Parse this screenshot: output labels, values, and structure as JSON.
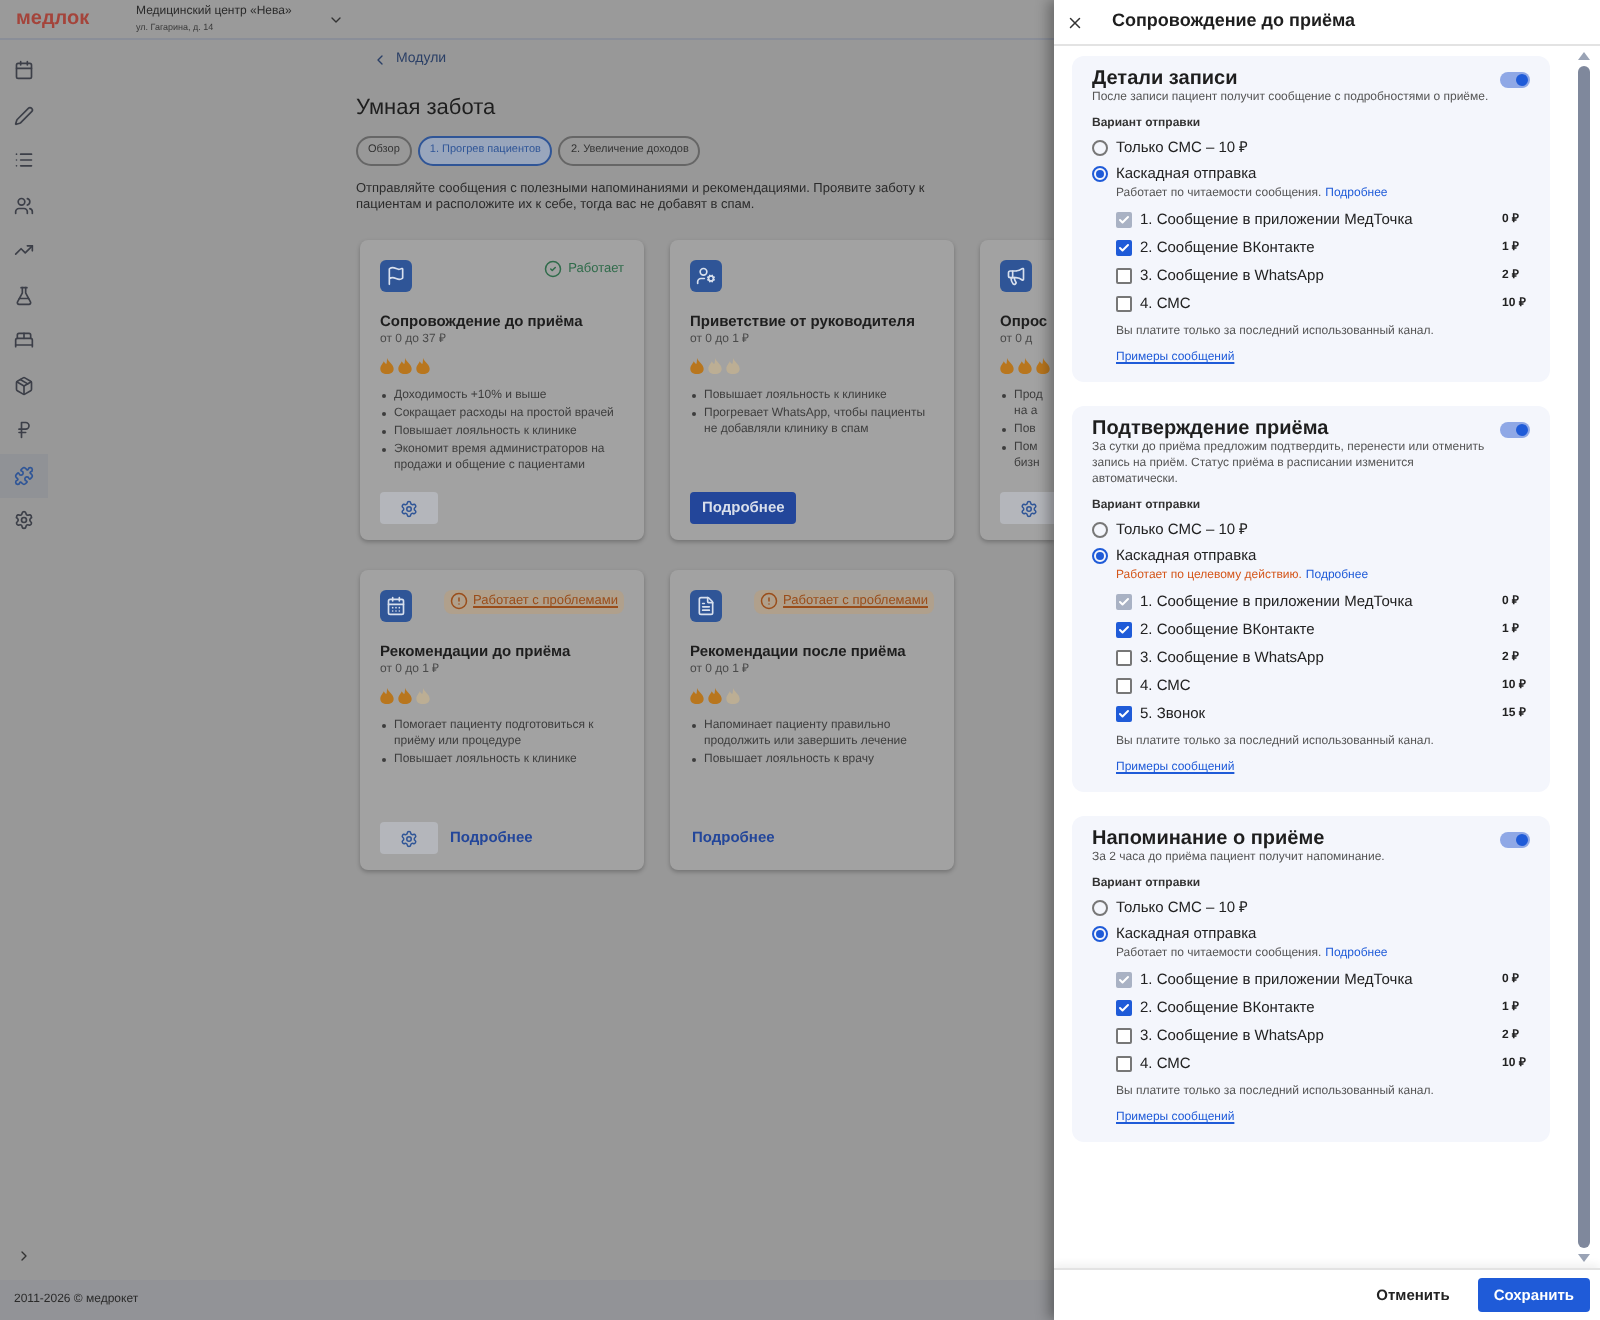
{
  "header": {
    "logo": "медлок",
    "clinic_name": "Медицинский центр «Нева»",
    "clinic_address": "ул. Гагарина, д. 14"
  },
  "sidebar": {
    "items": [
      {
        "selected": false
      },
      {
        "selected": false
      },
      {
        "selected": false
      },
      {
        "selected": false
      },
      {
        "selected": false
      },
      {
        "selected": false
      },
      {
        "selected": false
      },
      {
        "selected": false
      },
      {
        "selected": false
      },
      {
        "selected": true
      },
      {
        "selected": false
      }
    ]
  },
  "breadcrumb": "Модули",
  "page_title": "Умная забота",
  "tabs": [
    {
      "label": "Обзор",
      "selected": false
    },
    {
      "label": "1. Прогрев пациентов",
      "selected": true
    },
    {
      "label": "2. Увеличение доходов",
      "selected": false
    }
  ],
  "intro": "Отправляйте сообщения с полезными напоминаниями и рекомендациями. Проявите заботу к пациентам и расположите их к себе, тогда вас не добавят в спам.",
  "cards": [
    {
      "kind": "flag",
      "status": {
        "kind": "ok",
        "label": "Работает"
      },
      "title": "Сопровождение до приёма",
      "price": "от 0 до 37 ₽",
      "stars": 3,
      "bullets": [
        "Доходимость +10% и выше",
        "Сокращает расходы на простой врачей",
        "Повышает лояльность к клинике",
        "Экономит время администраторов на продажи и общение с пациентами"
      ],
      "settings_button": true
    },
    {
      "kind": "person",
      "title": "Приветствие от руководителя",
      "price": "от 0 до 1 ₽",
      "stars": 1,
      "bullets": [
        "Повышает лояльность к клинике",
        "Прогревает WhatsApp, чтобы пациенты не добавляли клинику в спам"
      ],
      "settings_button": false,
      "details": {
        "kind": "primary",
        "label": "Подробнее"
      }
    },
    {
      "kind": "megaphone",
      "title": "Опрос",
      "price": "от 0 д",
      "stars": 3,
      "bullets": [
        "Прод на а",
        "Пов",
        "Пом бизн"
      ],
      "settings_button": true
    },
    {
      "kind": "calendar",
      "status": {
        "kind": "problem",
        "label": "Работает с проблемами"
      },
      "title": "Рекомендации до приёма",
      "price": "от 0 до 1 ₽",
      "stars": 2,
      "bullets": [
        "Помогает пациенту подготовиться к приёму или процедуре",
        "Повышает лояльность к клинике"
      ],
      "settings_button": true,
      "details": {
        "kind": "link",
        "label": "Подробнее"
      }
    },
    {
      "kind": "document",
      "status": {
        "kind": "problem",
        "label": "Работает с проблемами"
      },
      "title": "Рекомендации после приёма",
      "price": "от 0 до 1 ₽",
      "stars": 2,
      "bullets": [
        "Напоминает пациенту правильно продолжить или завершить лечение",
        "Повышает лояльность к врачу"
      ],
      "settings_button": false,
      "details": {
        "kind": "link",
        "label": "Подробнее"
      }
    }
  ],
  "footer": "2011-2026 © медрокет",
  "panel": {
    "title": "Сопровождение до приёма",
    "sections": [
      {
        "title": "Детали записи",
        "enabled": true,
        "description": "После записи пациент получит сообщение с подробностями о приёме.",
        "variant_label": "Вариант отправки",
        "options": [
          {
            "label": "Только СМС – 10 ₽",
            "selected": false
          },
          {
            "label": "Каскадная отправка",
            "selected": true
          }
        ],
        "note": {
          "kind": "normal",
          "text": "Работает по читаемости сообщения.",
          "link": "Подробнее"
        },
        "channels": [
          {
            "label": "1. Сообщение в приложении МедТочка",
            "price": "0 ₽",
            "checked": true,
            "disabled": true
          },
          {
            "label": "2. Сообщение ВКонтакте",
            "price": "1 ₽",
            "checked": true,
            "disabled": false
          },
          {
            "label": "3. Сообщение в WhatsApp",
            "price": "2 ₽",
            "checked": false,
            "disabled": false
          },
          {
            "label": "4. СМС",
            "price": "10 ₽",
            "checked": false,
            "disabled": false
          }
        ],
        "payment_note": "Вы платите только за последний использованный канал.",
        "examples_link": "Примеры сообщений"
      },
      {
        "title": "Подтверждение приёма",
        "enabled": true,
        "description": "За сутки до приёма предложим подтвердить, перенести или отменить запись на приём. Статус приёма в расписании изменится автоматически.",
        "variant_label": "Вариант отправки",
        "options": [
          {
            "label": "Только СМС – 10 ₽",
            "selected": false
          },
          {
            "label": "Каскадная отправка",
            "selected": true
          }
        ],
        "note": {
          "kind": "warning",
          "text": "Работает по целевому действию.",
          "link": "Подробнее"
        },
        "channels": [
          {
            "label": "1. Сообщение в приложении МедТочка",
            "price": "0 ₽",
            "checked": true,
            "disabled": true
          },
          {
            "label": "2. Сообщение ВКонтакте",
            "price": "1 ₽",
            "checked": true,
            "disabled": false
          },
          {
            "label": "3. Сообщение в WhatsApp",
            "price": "2 ₽",
            "checked": false,
            "disabled": false
          },
          {
            "label": "4. СМС",
            "price": "10 ₽",
            "checked": false,
            "disabled": false
          },
          {
            "label": "5. Звонок",
            "price": "15 ₽",
            "checked": true,
            "disabled": false
          }
        ],
        "payment_note": "Вы платите только за последний использованный канал.",
        "examples_link": "Примеры сообщений"
      },
      {
        "title": "Напоминание о приёме",
        "enabled": true,
        "description": "За 2 часа до приёма пациент получит напоминание.",
        "variant_label": "Вариант отправки",
        "options": [
          {
            "label": "Только СМС – 10 ₽",
            "selected": false
          },
          {
            "label": "Каскадная отправка",
            "selected": true
          }
        ],
        "note": {
          "kind": "normal",
          "text": "Работает по читаемости сообщения.",
          "link": "Подробнее"
        },
        "channels": [
          {
            "label": "1. Сообщение в приложении МедТочка",
            "price": "0 ₽",
            "checked": true,
            "disabled": true
          },
          {
            "label": "2. Сообщение ВКонтакте",
            "price": "1 ₽",
            "checked": true,
            "disabled": false
          },
          {
            "label": "3. Сообщение в WhatsApp",
            "price": "2 ₽",
            "checked": false,
            "disabled": false
          },
          {
            "label": "4. СМС",
            "price": "10 ₽",
            "checked": false,
            "disabled": false
          }
        ],
        "payment_note": "Вы платите только за последний использованный канал.",
        "examples_link": "Примеры сообщений"
      }
    ],
    "buttons": {
      "cancel": "Отменить",
      "save": "Сохранить"
    }
  }
}
